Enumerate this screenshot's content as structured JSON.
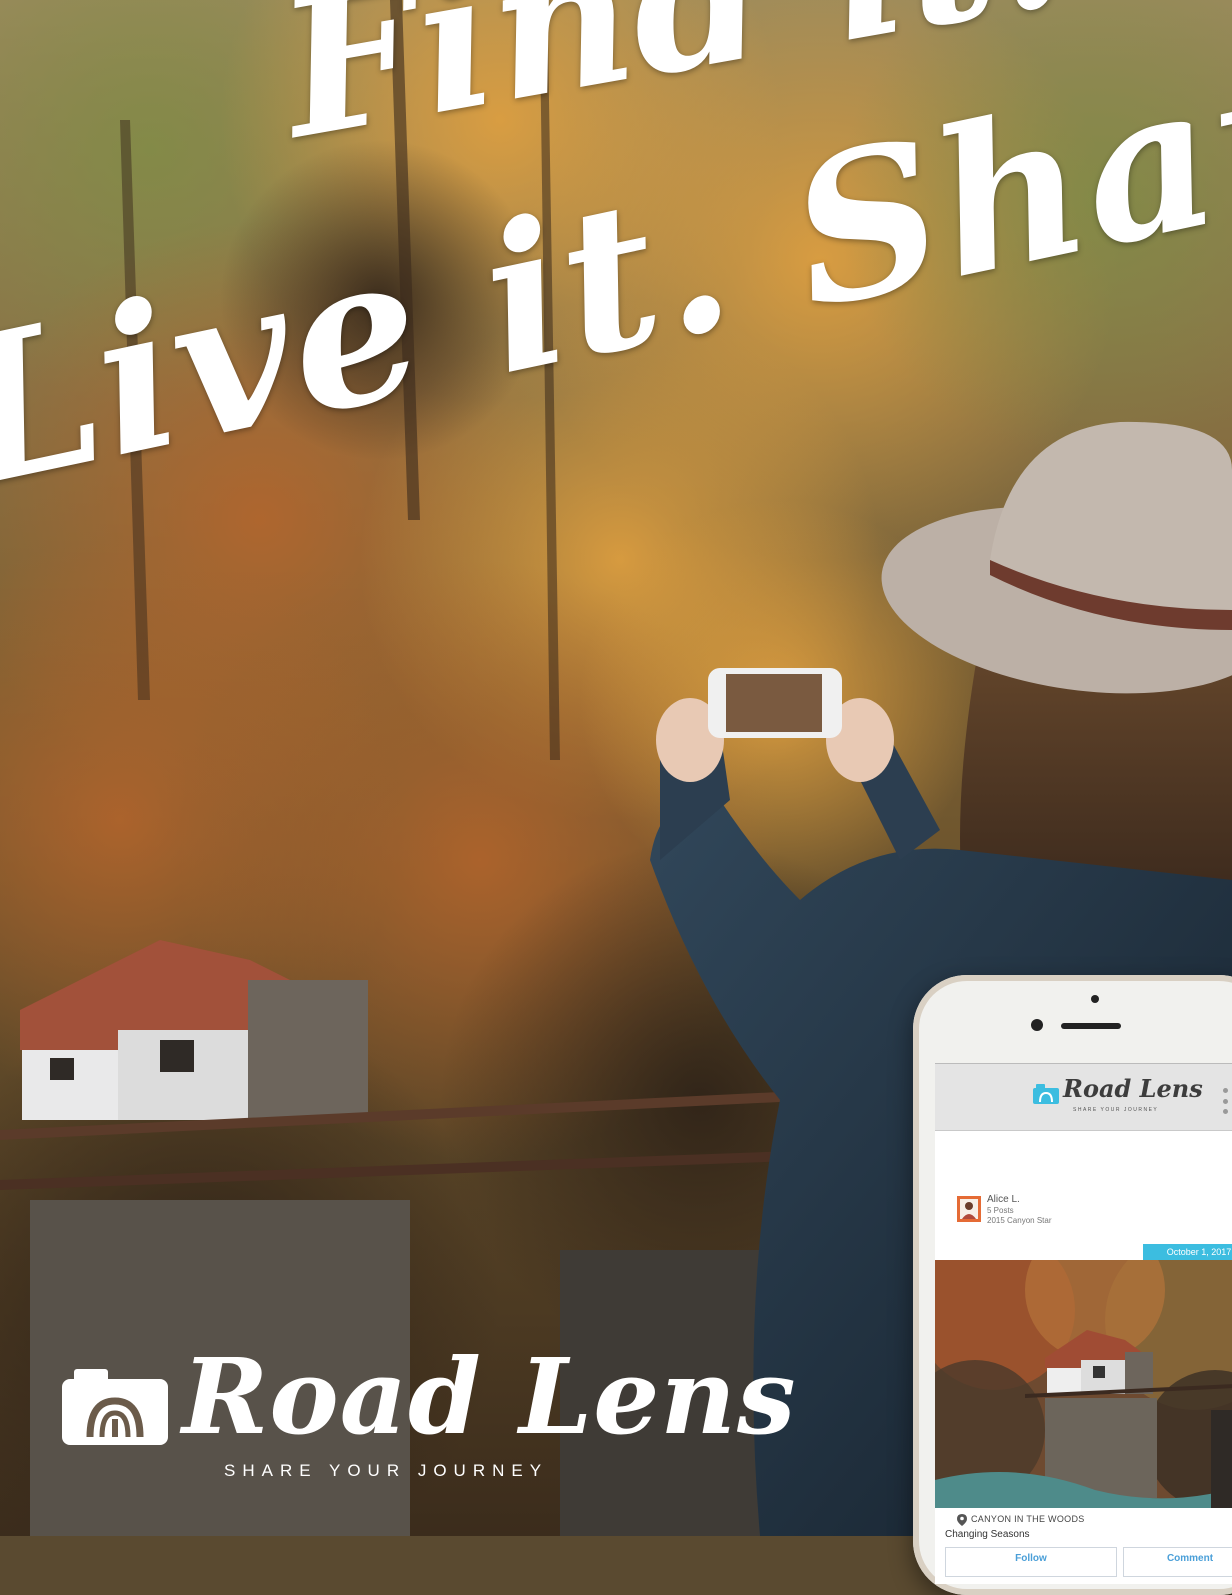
{
  "headline": {
    "line1": "Find it.",
    "line2": "Live it. Share it."
  },
  "brand": {
    "name": "Road Lens",
    "tagline": "SHARE YOUR JOURNEY"
  },
  "app": {
    "logo_text": "Road Lens",
    "logo_tagline": "SHARE YOUR JOURNEY",
    "post": {
      "author_name": "Alice L.",
      "author_posts": "5 Posts",
      "author_badge": "2015 Canyon Star",
      "date": "October 1, 2017",
      "location": "CANYON IN THE WOODS",
      "title": "Changing Seasons",
      "follow_label": "Follow",
      "comment_label": "Comment"
    }
  },
  "colors": {
    "accent": "#3cbde0",
    "link": "#4a9fd8",
    "avatar": "#e56b35"
  },
  "icons": [
    "camera-logo-icon",
    "location-pin-icon",
    "menu-dots-icon"
  ]
}
